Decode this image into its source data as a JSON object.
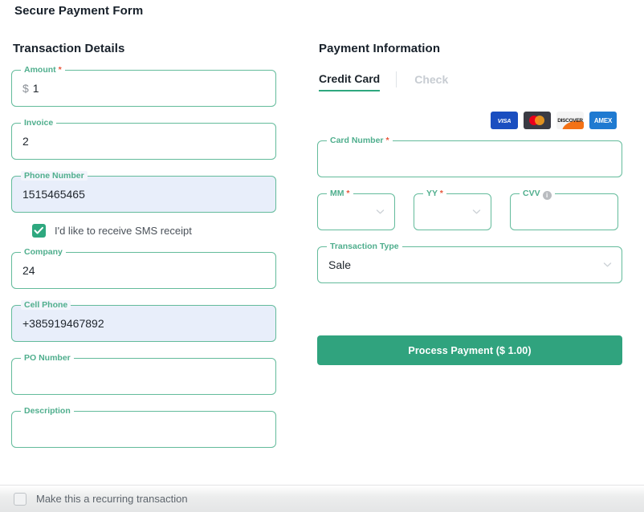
{
  "page": {
    "title": "Secure Payment Form"
  },
  "left": {
    "section_title": "Transaction Details",
    "fields": [
      {
        "label": "Amount",
        "required": true,
        "prefix": "$",
        "value": "1",
        "autofill": false
      },
      {
        "label": "Invoice",
        "required": false,
        "prefix": "",
        "value": "2",
        "autofill": false
      },
      {
        "label": "Phone Number",
        "required": false,
        "prefix": "",
        "value": "1515465465",
        "autofill": true
      },
      {
        "label": "Company",
        "required": false,
        "prefix": "",
        "value": "24",
        "autofill": false
      },
      {
        "label": "Cell Phone",
        "required": false,
        "prefix": "",
        "value": "+385919467892",
        "autofill": true
      },
      {
        "label": "PO Number",
        "required": false,
        "prefix": "",
        "value": "",
        "autofill": false
      },
      {
        "label": "Description",
        "required": false,
        "prefix": "",
        "value": "",
        "autofill": false
      }
    ],
    "sms_checkbox": {
      "label": "I'd like to receive SMS receipt",
      "checked": true
    }
  },
  "right": {
    "section_title": "Payment Information",
    "tabs": [
      {
        "label": "Credit Card",
        "active": true
      },
      {
        "label": "Check",
        "active": false
      }
    ],
    "brands": [
      {
        "name": "visa-logo",
        "text": "VISA"
      },
      {
        "name": "mastercard-logo",
        "text": ""
      },
      {
        "name": "discover-logo",
        "text": "DISCOVER"
      },
      {
        "name": "amex-logo",
        "text": "AMEX"
      }
    ],
    "card_number": {
      "label": "Card Number",
      "required": true,
      "value": ""
    },
    "expiry_mm": {
      "label": "MM",
      "required": true,
      "value": ""
    },
    "expiry_yy": {
      "label": "YY",
      "required": true,
      "value": ""
    },
    "cvv": {
      "label": "CVV",
      "required": false,
      "value": "",
      "info": "i"
    },
    "transaction_type": {
      "label": "Transaction Type",
      "value": "Sale"
    },
    "submit_label": "Process Payment ($ 1.00)"
  },
  "footer": {
    "recurring_label": "Make this a recurring transaction",
    "checked": false
  },
  "colors": {
    "accent_green": "#30a37e",
    "field_border": "#63bb9b",
    "label_green": "#4fae8d",
    "required_red": "#e8553a",
    "autofill_blue": "#e8eefa"
  }
}
